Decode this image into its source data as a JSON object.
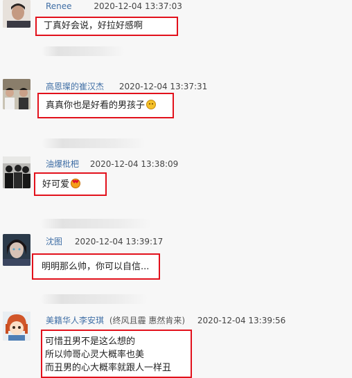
{
  "comments": [
    {
      "username": "Renee",
      "timestamp": "2020-12-04 13:37:03",
      "text": "丁真好会说，好拉好感啊"
    },
    {
      "username": "高恩璨的崔汉杰",
      "timestamp": "2020-12-04 13:37:31",
      "text": "真真你也是好看的男孩子",
      "emoji": "smile-emoji"
    },
    {
      "username": "油爆枇杷",
      "timestamp": "2020-12-04 13:38:09",
      "text": "好可爱",
      "emoji": "heart-eyes-emoji"
    },
    {
      "username": "沈图",
      "timestamp": "2020-12-04 13:39:17",
      "text": "明明那么帅，你可以自信..."
    },
    {
      "username": "美籍华人李安琪",
      "badge": "(终风且霾 惠然肯来)",
      "timestamp": "2020-12-04 13:39:56",
      "lines": [
        "可惜丑男不是这么想的",
        "所以帅哥心灵大概率也美",
        "而丑男的心大概率就跟人一样丑"
      ]
    }
  ],
  "colors": {
    "highlight_border": "#e2101b",
    "username": "#3f6ea5",
    "background": "#f7f7f7"
  }
}
